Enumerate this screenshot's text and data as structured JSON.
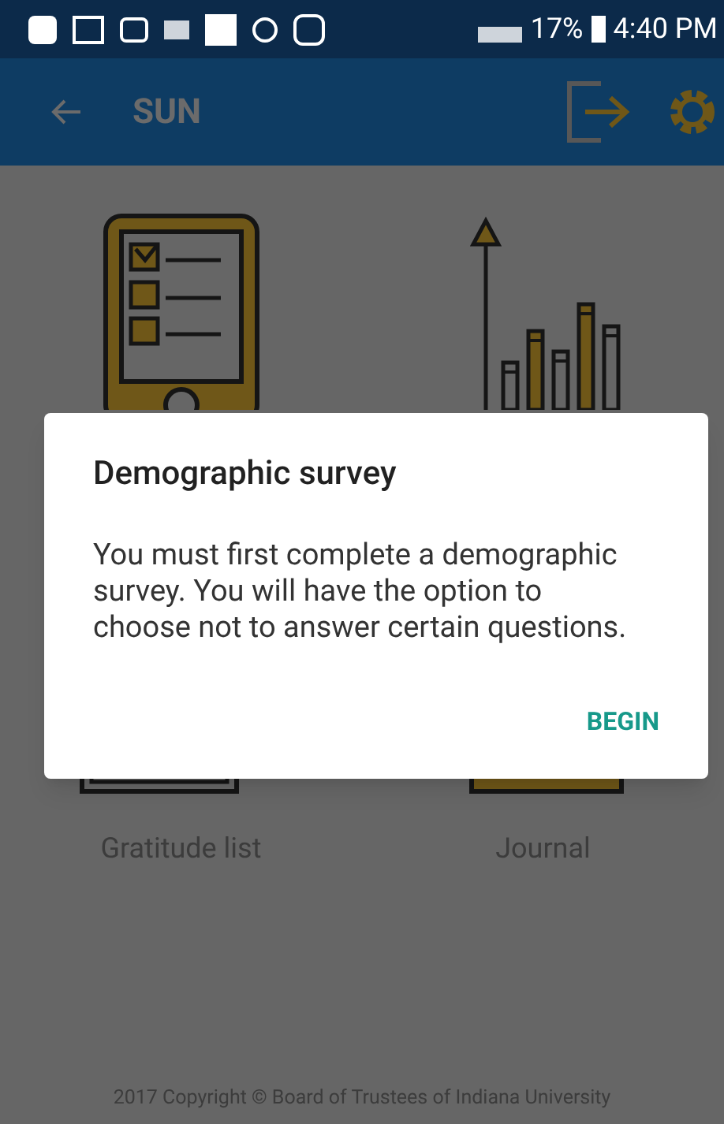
{
  "status_bar": {
    "battery": "17%",
    "time": "4:40 PM"
  },
  "app_bar": {
    "title": "SUN"
  },
  "tiles": [
    {
      "kind": "checklist"
    },
    {
      "kind": "chart"
    },
    {
      "kind": "notepad",
      "label": "Gratitude list"
    },
    {
      "kind": "notebook",
      "label": "Journal"
    }
  ],
  "dialog": {
    "title": "Demographic survey",
    "message": "You must first complete a demographic survey. You will have the option to choose not to answer certain questions.",
    "action": "BEGIN"
  },
  "footer": "2017 Copyright © Board of Trustees of Indiana University"
}
